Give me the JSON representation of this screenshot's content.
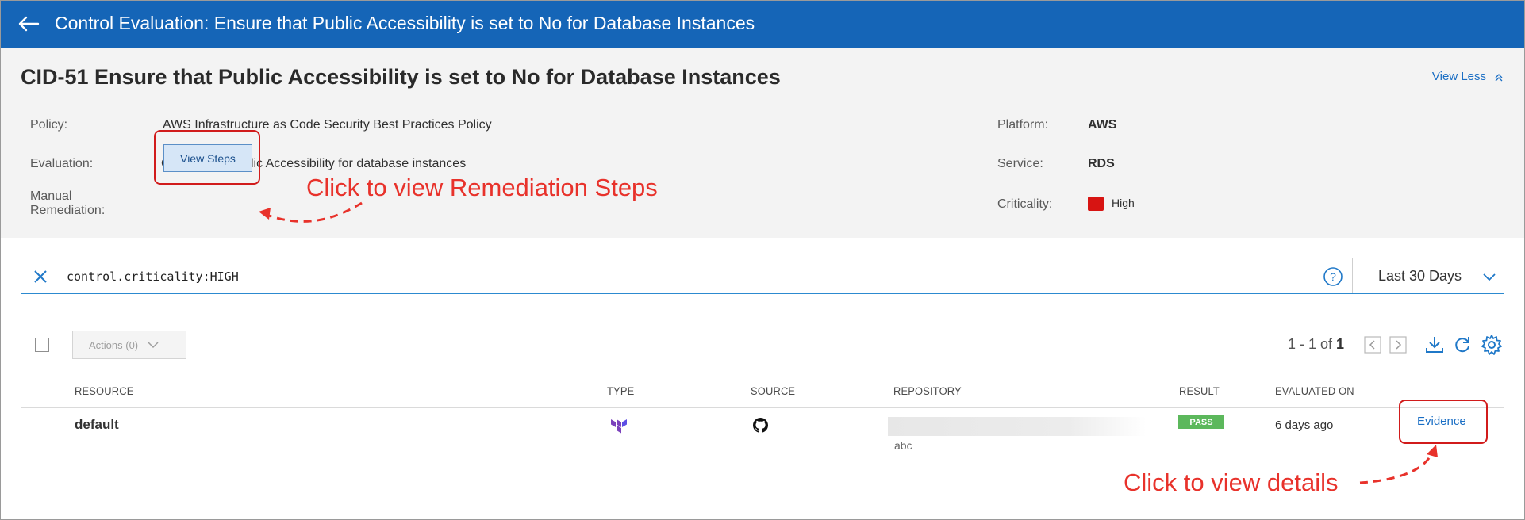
{
  "header": {
    "title": "Control Evaluation: Ensure that Public Accessibility is set to No for Database Instances",
    "bg_color": "#1565b7"
  },
  "control": {
    "title": "CID-51 Ensure that Public Accessibility is set to No for Database Instances",
    "view_less_label": "View Less",
    "policy_label": "Policy:",
    "policy_value": "AWS Infrastructure as Code Security Best Practices Policy",
    "evaluation_label": "Evaluation:",
    "evaluation_value": "Checks the Public Accessibility for database instances",
    "manual_label_line1": "Manual",
    "manual_label_line2": "Remediation:",
    "view_steps_label": "View Steps",
    "platform_label": "Platform:",
    "platform_value": "AWS",
    "service_label": "Service:",
    "service_value": "RDS",
    "criticality_label": "Criticality:",
    "criticality_value": "High",
    "criticality_color": "#d71412"
  },
  "annotations": {
    "remediation": "Click to view Remediation Steps",
    "details": "Click to view details",
    "color": "#e8322b"
  },
  "search": {
    "query": "control.criticality:HIGH",
    "range": "Last 30 Days"
  },
  "toolbar": {
    "actions_label": "Actions (0)",
    "pager_prefix": "1 - 1 of ",
    "pager_total": "1"
  },
  "table": {
    "columns": [
      "RESOURCE",
      "TYPE",
      "SOURCE",
      "REPOSITORY",
      "RESULT",
      "EVALUATED ON"
    ],
    "rows": [
      {
        "resource": "default",
        "type_icon": "terraform-icon",
        "source_icon": "github-icon",
        "repository": "abc",
        "result": "PASS",
        "evaluated_on": "6 days ago",
        "evidence_label": "Evidence"
      }
    ]
  }
}
